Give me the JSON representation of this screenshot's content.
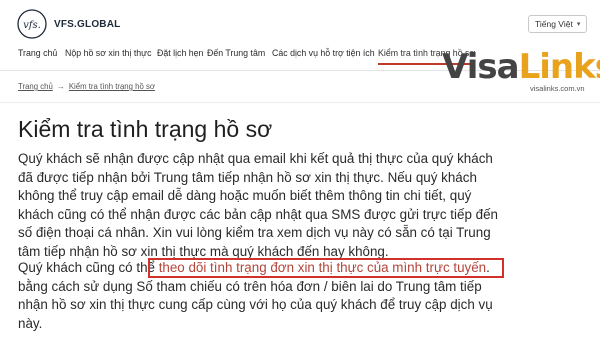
{
  "header": {
    "logo_mark": "vfs.",
    "logo_text": "VFS.GLOBAL",
    "language": "Tiếng Việt",
    "language_chevron": "chevron-down-icon"
  },
  "nav": {
    "items": [
      {
        "label": "Trang chủ"
      },
      {
        "label": "Nộp hồ sơ xin thị thực"
      },
      {
        "label": "Đặt lịch hẹn"
      },
      {
        "label": "Đến Trung tâm"
      },
      {
        "label": "Các dịch vụ hỗ trợ tiện ích"
      },
      {
        "label": "Kiểm tra tình trạng hồ sơ",
        "active": true
      }
    ],
    "active_color": "#c0392b"
  },
  "watermark": {
    "part1": "Visa",
    "part2": "Links",
    "domain": "visalinks.com.vn",
    "color_dark": "#444444",
    "color_accent": "#e8a21c"
  },
  "breadcrumb": {
    "home": "Trang chủ",
    "separator": "→",
    "current": "Kiểm tra tình trạng hồ sơ"
  },
  "page": {
    "title": "Kiểm tra tình trạng hồ sơ",
    "paragraph1_lines": [
      "Quý khách sẽ nhận được cập nhật qua email khi kết quả thị thực của quý khách",
      "đã được tiếp nhận bởi Trung tâm tiếp nhận hồ sơ xin thị thực. Nếu quý khách",
      "không thể truy cập email dễ dàng hoặc muốn biết thêm thông tin chi tiết, quý",
      "khách cũng có thể nhận được các bản cập nhật qua SMS được gửi trực tiếp đến",
      "số điện thoại cá nhân. Xin vui lòng kiểm tra xem dịch vụ này có sẵn có tại Trung",
      "tâm tiếp nhận hồ sơ xin thị thực mà quý khách đến hay không."
    ],
    "paragraph2_prefix": "Quý khách cũng có thể ",
    "paragraph2_link": "theo dõi tình trạng đơn xin thị thực của mình trực tuyến",
    "paragraph2_suffix": ".",
    "paragraph2_lines": [
      "bằng cách sử dụng Số tham chiếu có trên hóa đơn / biên lai do Trung tâm tiếp",
      "nhận hồ sơ xin thị thực cung cấp cùng với họ của quý khách để truy cập dịch vụ",
      "này."
    ],
    "highlight_color": "#d2302a",
    "link_color": "#b4453a"
  }
}
